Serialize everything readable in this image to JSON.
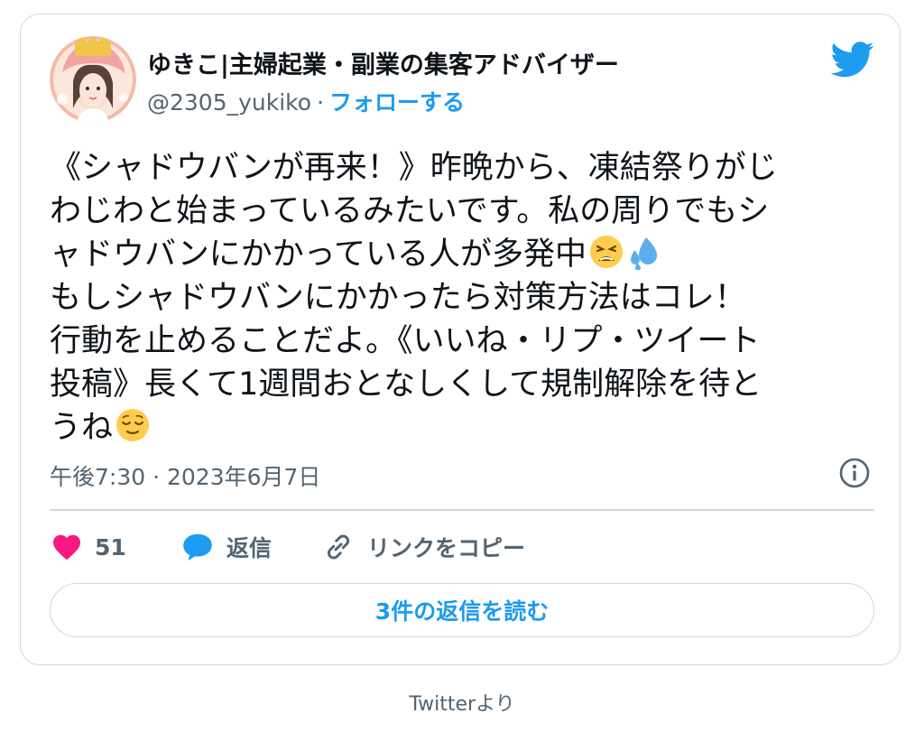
{
  "author": {
    "display_name": "ゆきこ|主婦起業・副業の集客アドバイザー",
    "handle": "@2305_yukiko",
    "separator": "·",
    "follow_label": "フォローする"
  },
  "tweet": {
    "lines": [
      "《シャドウバンが再来！》昨晩から、凍結祭りがじ",
      "わじわと始まっているみたいです。私の周りでもシ",
      "ャドウバンにかかっている人が多発中",
      "もしシャドウバンにかかったら対策方法はコレ！",
      "行動を止めることだよ。《いいね・リプ・ツイート",
      "投稿》長くて1週間おとなしくして規制解除を待と",
      "うね"
    ],
    "emojis": [
      "tired-face-emoji",
      "sweat-droplets-emoji",
      "relieved-face-emoji"
    ],
    "timestamp": "午後7:30 · 2023年6月7日"
  },
  "actions": {
    "like_count": "51",
    "reply_label": "返信",
    "copy_link_label": "リンクをコピー",
    "read_replies_label": "3件の返信を読む"
  },
  "source_label": "Twitterより",
  "colors": {
    "accent": "#1d9bf0",
    "like": "#f91880",
    "text": "#0f1419",
    "muted": "#536471",
    "border": "#cfd9de"
  }
}
